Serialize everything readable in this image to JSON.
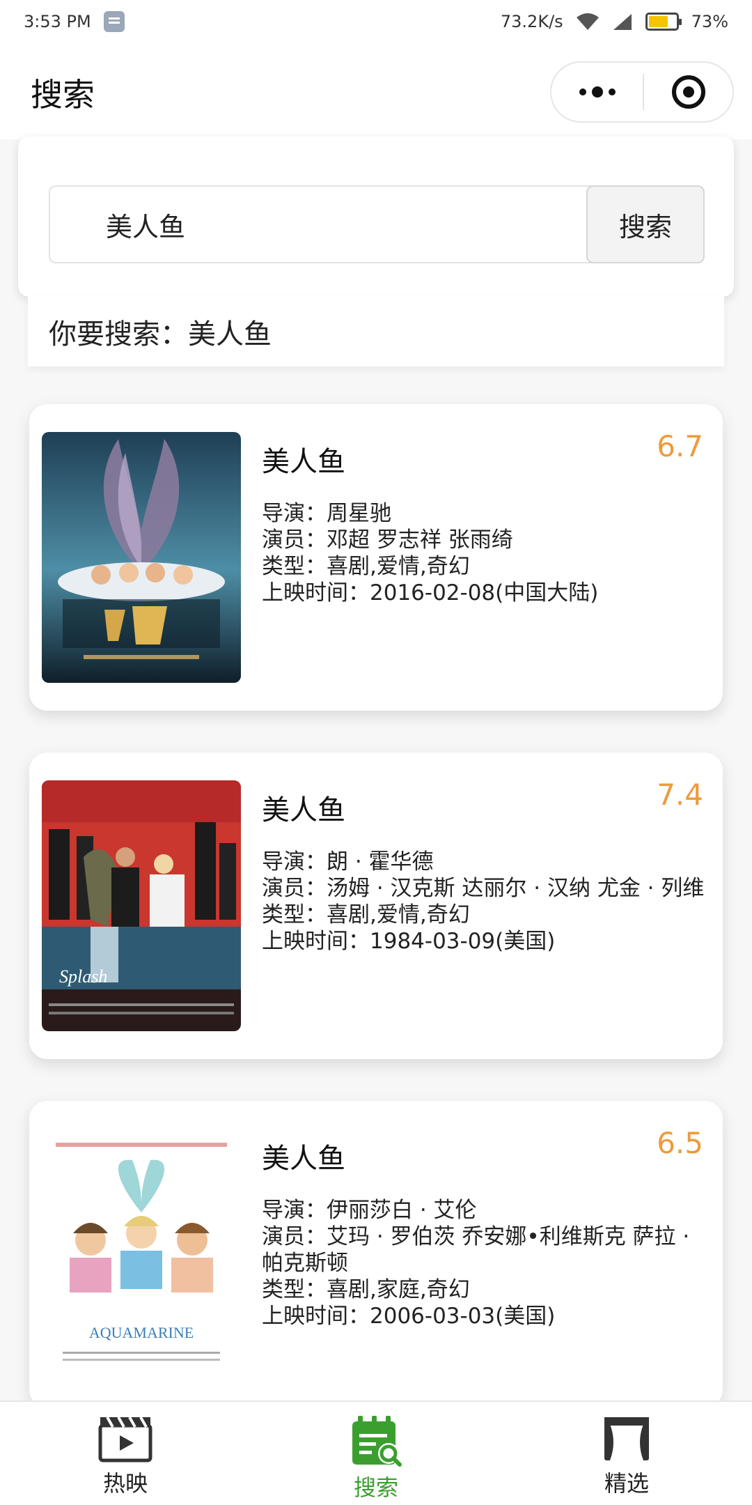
{
  "status_bar": {
    "time": "3:53 PM",
    "net_speed": "73.2K/s",
    "battery_percent": "73%",
    "battery_level": 0.73
  },
  "nav": {
    "title": "搜索"
  },
  "search": {
    "query": "美人鱼",
    "button_label": "搜索"
  },
  "result_header": "你要搜索：美人鱼",
  "movies": [
    {
      "title": "美人鱼",
      "rating": "6.7",
      "director": "导演：周星驰",
      "cast": "演员：邓超 罗志祥 张雨绮",
      "genre": "类型：喜剧,爱情,奇幻",
      "release": "上映时间：2016-02-08(中国大陆)"
    },
    {
      "title": "美人鱼",
      "rating": "7.4",
      "director": "导演：朗 · 霍华德",
      "cast": "演员：汤姆 · 汉克斯 达丽尔 · 汉纳 尤金 · 列维",
      "genre": "类型：喜剧,爱情,奇幻",
      "release": "上映时间：1984-03-09(美国)"
    },
    {
      "title": "美人鱼",
      "rating": "6.5",
      "director": "导演：伊丽莎白 · 艾伦",
      "cast": "演员：艾玛 · 罗伯茨 乔安娜•利维斯克 萨拉 · 帕克斯顿",
      "genre": "类型：喜剧,家庭,奇幻",
      "release": "上映时间：2006-03-03(美国)"
    }
  ],
  "tabbar": {
    "items": [
      {
        "label": "热映",
        "icon": "clapperboard-icon"
      },
      {
        "label": "搜索",
        "icon": "search-calendar-icon"
      },
      {
        "label": "精选",
        "icon": "stage-curtain-icon"
      }
    ],
    "active_index": 1,
    "active_color": "#3a9f2e"
  },
  "colors": {
    "rating": "#ee9a3c",
    "accent_green": "#3a9f2e"
  }
}
